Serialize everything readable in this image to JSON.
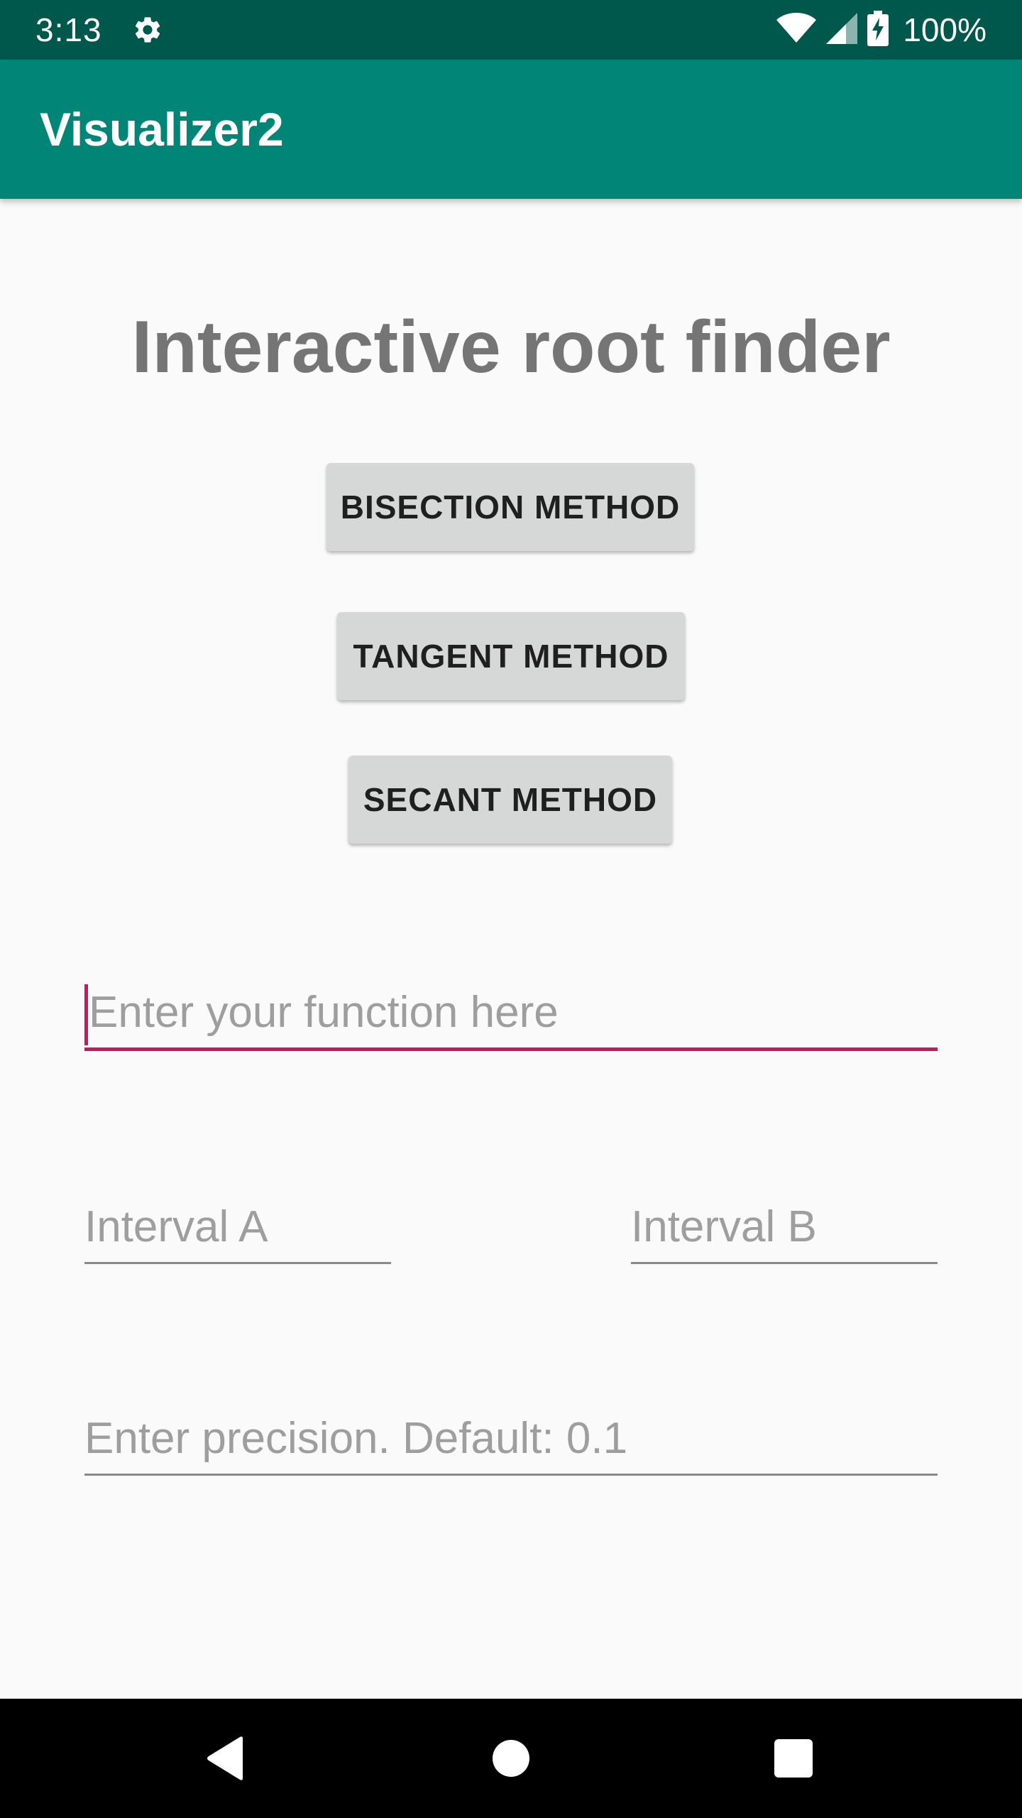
{
  "status_bar": {
    "time": "3:13",
    "battery": "100%",
    "icons": [
      "gear-icon",
      "wifi-icon",
      "signal-icon",
      "battery-charging-icon"
    ]
  },
  "app_bar": {
    "title": "Visualizer2"
  },
  "main": {
    "heading": "Interactive root finder",
    "buttons": {
      "bisection": "BISECTION METHOD",
      "tangent": "TANGENT METHOD",
      "secant": "SECANT METHOD"
    },
    "fields": {
      "function": {
        "value": "",
        "placeholder": "Enter your function here"
      },
      "interval_a": {
        "value": "",
        "placeholder": "Interval A"
      },
      "interval_b": {
        "value": "",
        "placeholder": "Interval B"
      },
      "precision": {
        "value": "",
        "placeholder": "Enter precision. Default: 0.1"
      }
    }
  },
  "nav_bar": {
    "icons": [
      "back-icon",
      "home-icon",
      "recents-icon"
    ]
  },
  "colors": {
    "status_bar": "#00574b",
    "app_bar": "#008577",
    "accent": "#c8175d",
    "background": "#fafafa",
    "button": "#d6d7d7"
  }
}
